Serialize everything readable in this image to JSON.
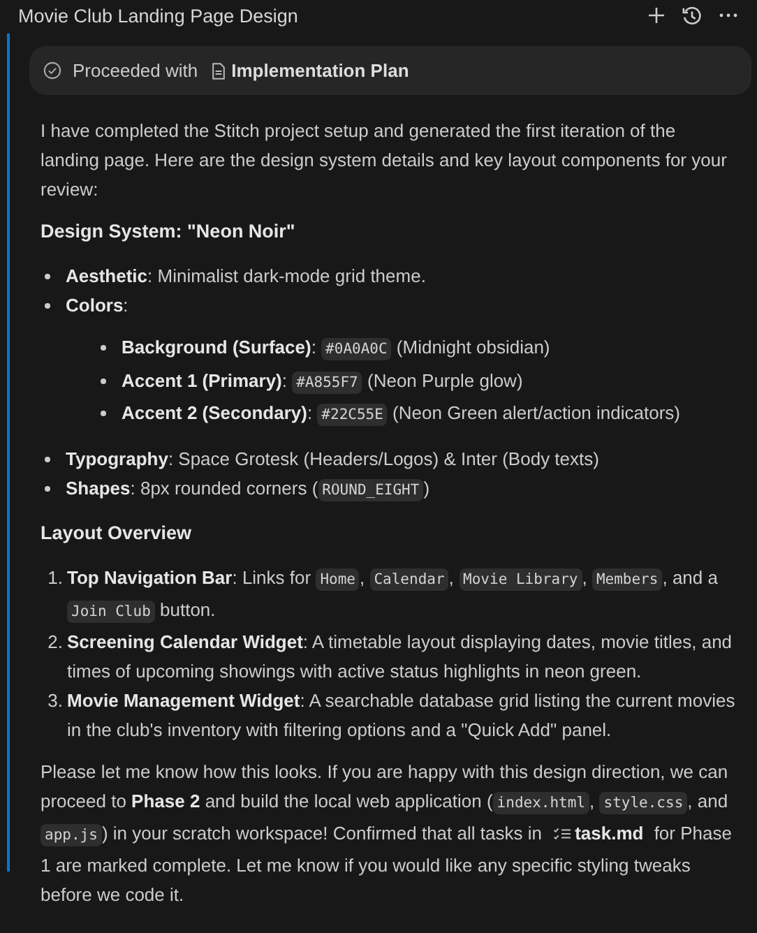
{
  "header": {
    "title": "Movie Club Landing Page Design"
  },
  "status_chip": {
    "label": "Proceeded with",
    "file": "Implementation Plan"
  },
  "blocks": [
    {
      "kind": "paragraph",
      "parts": [
        {
          "kind": "plain",
          "text": "I have completed the Stitch project setup and generated the first iteration of the landing page. Here are the design system details and key layout components for your review:"
        }
      ]
    },
    {
      "kind": "heading",
      "text": "Design System: \"Neon Noir\""
    },
    {
      "kind": "bullets",
      "items": [
        {
          "parts": [
            {
              "kind": "bold",
              "text": "Aesthetic"
            },
            {
              "kind": "plain",
              "text": ": Minimalist dark-mode grid theme."
            }
          ]
        },
        {
          "parts": [
            {
              "kind": "bold",
              "text": "Colors"
            },
            {
              "kind": "plain",
              "text": ":"
            }
          ],
          "children": [
            {
              "parts": [
                {
                  "kind": "bold",
                  "text": "Background (Surface)"
                },
                {
                  "kind": "plain",
                  "text": ": "
                },
                {
                  "kind": "code",
                  "text": "#0A0A0C"
                },
                {
                  "kind": "plain",
                  "text": " (Midnight obsidian)"
                }
              ]
            },
            {
              "parts": [
                {
                  "kind": "bold",
                  "text": "Accent 1 (Primary)"
                },
                {
                  "kind": "plain",
                  "text": ": "
                },
                {
                  "kind": "code",
                  "text": "#A855F7"
                },
                {
                  "kind": "plain",
                  "text": " (Neon Purple glow)"
                }
              ]
            },
            {
              "parts": [
                {
                  "kind": "bold",
                  "text": "Accent 2 (Secondary)"
                },
                {
                  "kind": "plain",
                  "text": ": "
                },
                {
                  "kind": "code",
                  "text": "#22C55E"
                },
                {
                  "kind": "plain",
                  "text": " (Neon Green alert/action indicators)"
                }
              ]
            }
          ]
        },
        {
          "parts": [
            {
              "kind": "bold",
              "text": "Typography"
            },
            {
              "kind": "plain",
              "text": ": Space Grotesk (Headers/Logos) & Inter (Body texts)"
            }
          ]
        },
        {
          "parts": [
            {
              "kind": "bold",
              "text": "Shapes"
            },
            {
              "kind": "plain",
              "text": ": 8px rounded corners ("
            },
            {
              "kind": "code",
              "text": "ROUND_EIGHT"
            },
            {
              "kind": "plain",
              "text": ")"
            }
          ]
        }
      ]
    },
    {
      "kind": "heading",
      "text": "Layout Overview"
    },
    {
      "kind": "numbered",
      "items": [
        {
          "marker": "1.",
          "parts": [
            {
              "kind": "bold",
              "text": "Top Navigation Bar"
            },
            {
              "kind": "plain",
              "text": ": Links for "
            },
            {
              "kind": "code",
              "text": "Home"
            },
            {
              "kind": "plain",
              "text": ", "
            },
            {
              "kind": "code",
              "text": "Calendar"
            },
            {
              "kind": "plain",
              "text": ", "
            },
            {
              "kind": "code",
              "text": "Movie Library"
            },
            {
              "kind": "plain",
              "text": ", "
            },
            {
              "kind": "code",
              "text": "Members"
            },
            {
              "kind": "plain",
              "text": ", and a "
            },
            {
              "kind": "code",
              "text": "Join Club"
            },
            {
              "kind": "plain",
              "text": " button."
            }
          ]
        },
        {
          "marker": "2.",
          "parts": [
            {
              "kind": "bold",
              "text": "Screening Calendar Widget"
            },
            {
              "kind": "plain",
              "text": ": A timetable layout displaying dates, movie titles, and times of upcoming showings with active status highlights in neon green."
            }
          ]
        },
        {
          "marker": "3.",
          "parts": [
            {
              "kind": "bold",
              "text": "Movie Management Widget"
            },
            {
              "kind": "plain",
              "text": ": A searchable database grid listing the current movies in the club's inventory with filtering options and a \"Quick Add\" panel."
            }
          ]
        }
      ]
    },
    {
      "kind": "paragraph",
      "parts": [
        {
          "kind": "plain",
          "text": "Please let me know how this looks. If you are happy with this design direction, we can proceed to "
        },
        {
          "kind": "bold",
          "text": "Phase 2"
        },
        {
          "kind": "plain",
          "text": " and build the local web application ("
        },
        {
          "kind": "code",
          "text": "index.html"
        },
        {
          "kind": "plain",
          "text": ", "
        },
        {
          "kind": "code",
          "text": "style.css"
        },
        {
          "kind": "plain",
          "text": ", and "
        },
        {
          "kind": "code",
          "text": "app.js"
        },
        {
          "kind": "plain",
          "text": ") in your scratch workspace! Confirmed that all tasks in "
        },
        {
          "kind": "file",
          "text": "task.md"
        },
        {
          "kind": "plain",
          "text": " for Phase 1 are marked complete. Let me know if you would like any specific styling tweaks before we code it."
        }
      ]
    }
  ]
}
